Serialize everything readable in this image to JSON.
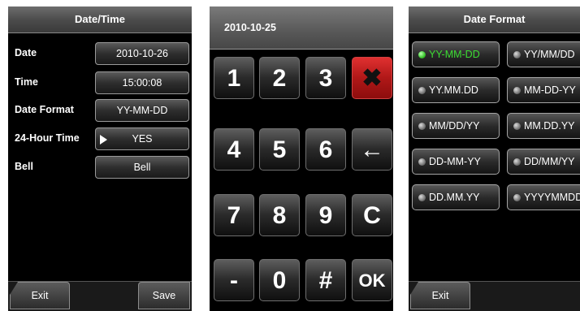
{
  "screen1": {
    "title": "Date/Time",
    "rows": [
      {
        "label": "Date",
        "value": "2010-10-26"
      },
      {
        "label": "Time",
        "value": "15:00:08"
      },
      {
        "label": "Date Format",
        "value": "YY-MM-DD"
      },
      {
        "label": "24-Hour Time",
        "value": "YES"
      },
      {
        "label": "Bell",
        "value": "Bell"
      }
    ],
    "exit_label": "Exit",
    "save_label": "Save"
  },
  "screen2": {
    "display_value": "2010-10-25",
    "keys": [
      "1",
      "2",
      "3",
      "✖",
      "4",
      "5",
      "6",
      "←",
      "7",
      "8",
      "9",
      "C",
      "-",
      "0",
      "#",
      "OK"
    ]
  },
  "screen3": {
    "title": "Date Format",
    "formats": [
      "YY-MM-DD",
      "YY/MM/DD",
      "YY.MM.DD",
      "MM-DD-YY",
      "MM/DD/YY",
      "MM.DD.YY",
      "DD-MM-YY",
      "DD/MM/YY",
      "DD.MM.YY",
      "YYYYMMDD"
    ],
    "selected": "YY-MM-DD",
    "exit_label": "Exit"
  },
  "colors": {
    "selected_text": "#3cdc32",
    "delete_key": "#c41e1e"
  }
}
